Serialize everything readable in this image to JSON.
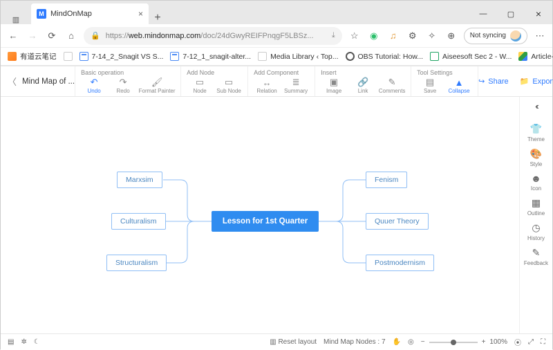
{
  "window": {
    "tab_title": "MindOnMap",
    "new_tab_tip": "+",
    "close": "×",
    "min": "—",
    "max": "▢"
  },
  "url": {
    "protocol": "https://",
    "host": "web.mindonmap.com",
    "path": "/doc/24dGwyREIFPnqgF5LBSz...",
    "readermode": "",
    "sync": "Not syncing"
  },
  "bookmarks": [
    {
      "label": "有道云笔记"
    },
    {
      "label": "7-14_2_Snagit VS S..."
    },
    {
      "label": "7-12_1_snagit-alter..."
    },
    {
      "label": "Media Library ‹ Top..."
    },
    {
      "label": "OBS Tutorial: How..."
    },
    {
      "label": "Aiseesoft Sec 2 - W..."
    },
    {
      "label": "Article-Drafts - Goo..."
    }
  ],
  "doc": {
    "name": "Mind Map of ..."
  },
  "toolbar": {
    "groups": [
      {
        "label": "Basic operation",
        "items": [
          {
            "l": "Undo",
            "i": "↶",
            "a": true
          },
          {
            "l": "Redo",
            "i": "↷"
          },
          {
            "l": "Format Painter",
            "i": "🖌"
          }
        ]
      },
      {
        "label": "Add Node",
        "items": [
          {
            "l": "Node",
            "i": "▭"
          },
          {
            "l": "Sub Node",
            "i": "▭"
          }
        ]
      },
      {
        "label": "Add Component",
        "items": [
          {
            "l": "Relation",
            "i": "↔"
          },
          {
            "l": "Summary",
            "i": "≣"
          }
        ]
      },
      {
        "label": "Insert",
        "items": [
          {
            "l": "Image",
            "i": "▣"
          },
          {
            "l": "Link",
            "i": "🔗"
          },
          {
            "l": "Comments",
            "i": "✎"
          }
        ]
      },
      {
        "label": "Tool Settings",
        "items": [
          {
            "l": "Save",
            "i": "▤"
          },
          {
            "l": "Collapse",
            "i": "▲",
            "a": true
          }
        ]
      }
    ],
    "share": "Share",
    "export": "Export"
  },
  "side": [
    {
      "l": "Theme",
      "i": "👕"
    },
    {
      "l": "Style",
      "i": "🎨"
    },
    {
      "l": "Icon",
      "i": "☻"
    },
    {
      "l": "Outline",
      "i": "▦"
    },
    {
      "l": "History",
      "i": "◷"
    },
    {
      "l": "Feedback",
      "i": "✎"
    }
  ],
  "mindmap": {
    "center": "Lesson for  1st Quarter",
    "left": [
      "Marxsim",
      "Culturalism",
      "Structuralism"
    ],
    "right": [
      "Fenism",
      "Quuer Theory",
      "Postmodernism"
    ]
  },
  "status": {
    "reset": "Reset layout",
    "nodes_label": "Mind Map Nodes :",
    "nodes_count": "7",
    "zoom": "100%"
  }
}
